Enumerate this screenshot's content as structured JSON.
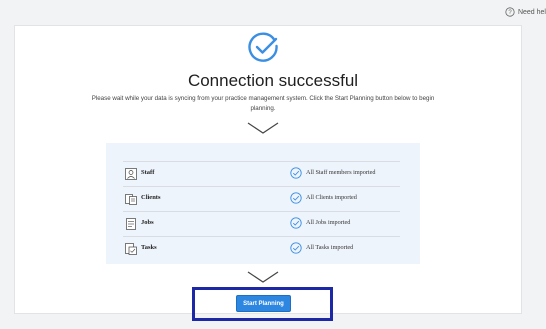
{
  "header": {
    "help_label": "Need hel",
    "help_icon": "question-circle-icon"
  },
  "main": {
    "status_icon": "check-circle-icon",
    "title": "Connection successful",
    "subtitle": "Please wait while your data is syncing from your practice management system. Click the Start Planning button below to begin planning.",
    "divider_icon": "chevron-down-icon"
  },
  "imports": [
    {
      "label": "Staff",
      "status": "All Staff members imported",
      "icon": "staff-icon"
    },
    {
      "label": "Clients",
      "status": "All Clients imported",
      "icon": "clients-icon"
    },
    {
      "label": "Jobs",
      "status": "All Jobs imported",
      "icon": "jobs-icon"
    },
    {
      "label": "Tasks",
      "status": "All Tasks imported",
      "icon": "tasks-icon"
    }
  ],
  "actions": {
    "start_label": "Start Planning"
  },
  "colors": {
    "accent": "#2d86e0",
    "highlight": "#1d28a6",
    "panel": "#eef4fc"
  }
}
